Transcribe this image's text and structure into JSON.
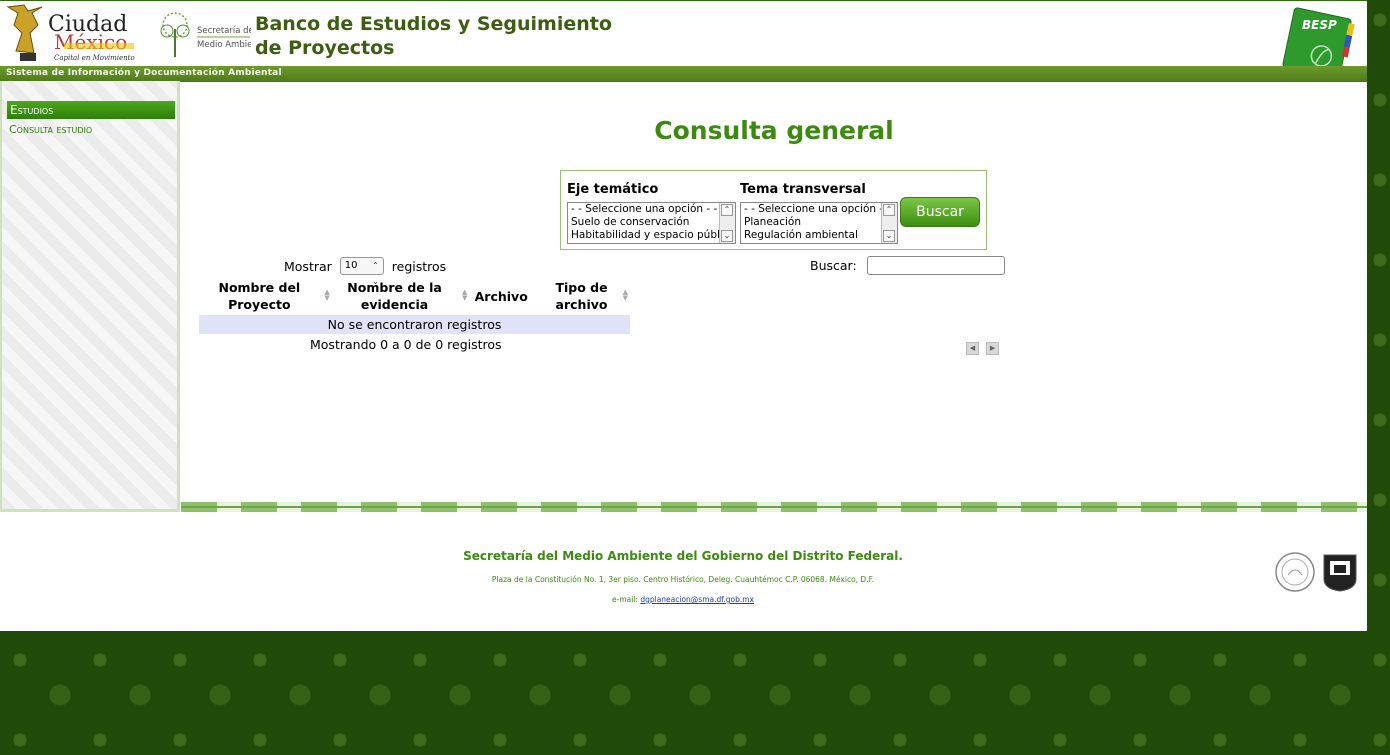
{
  "header": {
    "title": "Banco de Estudios y Seguimiento de Proyectos",
    "subtitle_bar": "Sistema de Información y Documentación Ambiental",
    "logo_cdmx": {
      "text_top": "Ciudad",
      "text_bottom": "México",
      "tagline": "Capital en Movimiento"
    },
    "logo_sma": {
      "line1": "Secretaría del",
      "line2": "Medio Ambiente"
    },
    "logo_besp": "BESP"
  },
  "sidebar": {
    "section": "Estudios",
    "items": [
      {
        "label": "Consulta estudio"
      }
    ]
  },
  "main": {
    "title": "Consulta general",
    "filters": {
      "eje": {
        "label": "Eje temático",
        "options": [
          "- - Seleccione una opción - -",
          "Suelo de conservación",
          "Habitabilidad y espacio público"
        ]
      },
      "tema": {
        "label": "Tema transversal",
        "options": [
          "- - Seleccione una opción - -",
          "Planeación",
          "Regulación ambiental"
        ]
      },
      "search_button": "Buscar"
    },
    "table": {
      "length_prefix": "Mostrar",
      "length_value": "10",
      "length_suffix": "registros",
      "search_label": "Buscar:",
      "search_value": "",
      "columns": [
        "Nombre del Proyecto",
        "Nombre de la evidencia",
        "Archivo",
        "Tipo de archivo"
      ],
      "empty_message": "No se encontraron registros",
      "info": "Mostrando 0 a 0 de 0 registros"
    }
  },
  "footer": {
    "org": "Secretaría del Medio Ambiente del Gobierno del Distrito Federal.",
    "address": "Plaza de la Constitución No. 1, 3er piso. Centro Histórico, Deleg. Cuauhtémoc C.P. 06068. México, D.F.",
    "email_label": "e-mail:",
    "email": "dgplaneacion@sma.df.gob.mx"
  },
  "colors": {
    "brand_green": "#3c8a0f",
    "dark_green": "#1f4a08",
    "empty_row": "#e1e3f8"
  }
}
